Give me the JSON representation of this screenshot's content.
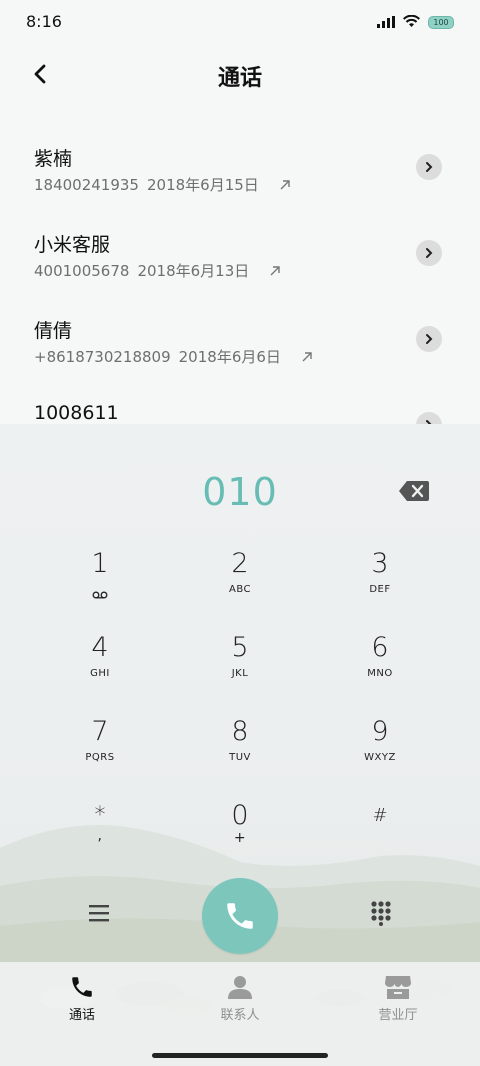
{
  "status_bar": {
    "time": "8:16",
    "battery": "100"
  },
  "header": {
    "title": "通话"
  },
  "calls": [
    {
      "name": "紫楠",
      "number": "18400241935",
      "date": "2018年6月15日"
    },
    {
      "name": "小米客服",
      "number": "4001005678",
      "date": "2018年6月13日"
    },
    {
      "name": "倩倩",
      "number": "+8618730218809",
      "date": "2018年6月6日"
    },
    {
      "name": "1008611",
      "number": "",
      "date": ""
    }
  ],
  "dialpad": {
    "number": "010",
    "keys": [
      {
        "digit": "1",
        "letters": ""
      },
      {
        "digit": "2",
        "letters": "ABC"
      },
      {
        "digit": "3",
        "letters": "DEF"
      },
      {
        "digit": "4",
        "letters": "GHI"
      },
      {
        "digit": "5",
        "letters": "JKL"
      },
      {
        "digit": "6",
        "letters": "MNO"
      },
      {
        "digit": "7",
        "letters": "PQRS"
      },
      {
        "digit": "8",
        "letters": "TUV"
      },
      {
        "digit": "9",
        "letters": "WXYZ"
      },
      {
        "digit": "*",
        "letters": ","
      },
      {
        "digit": "0",
        "letters": "+"
      },
      {
        "digit": "#",
        "letters": ""
      }
    ]
  },
  "tabs": [
    {
      "label": "通话",
      "icon": "phone-icon",
      "active": true
    },
    {
      "label": "联系人",
      "icon": "person-icon",
      "active": false
    },
    {
      "label": "营业厅",
      "icon": "store-icon",
      "active": false
    }
  ],
  "colors": {
    "accent": "#67bdb3",
    "call_button": "#7cc6bc",
    "text_secondary": "#6f6f6f"
  }
}
